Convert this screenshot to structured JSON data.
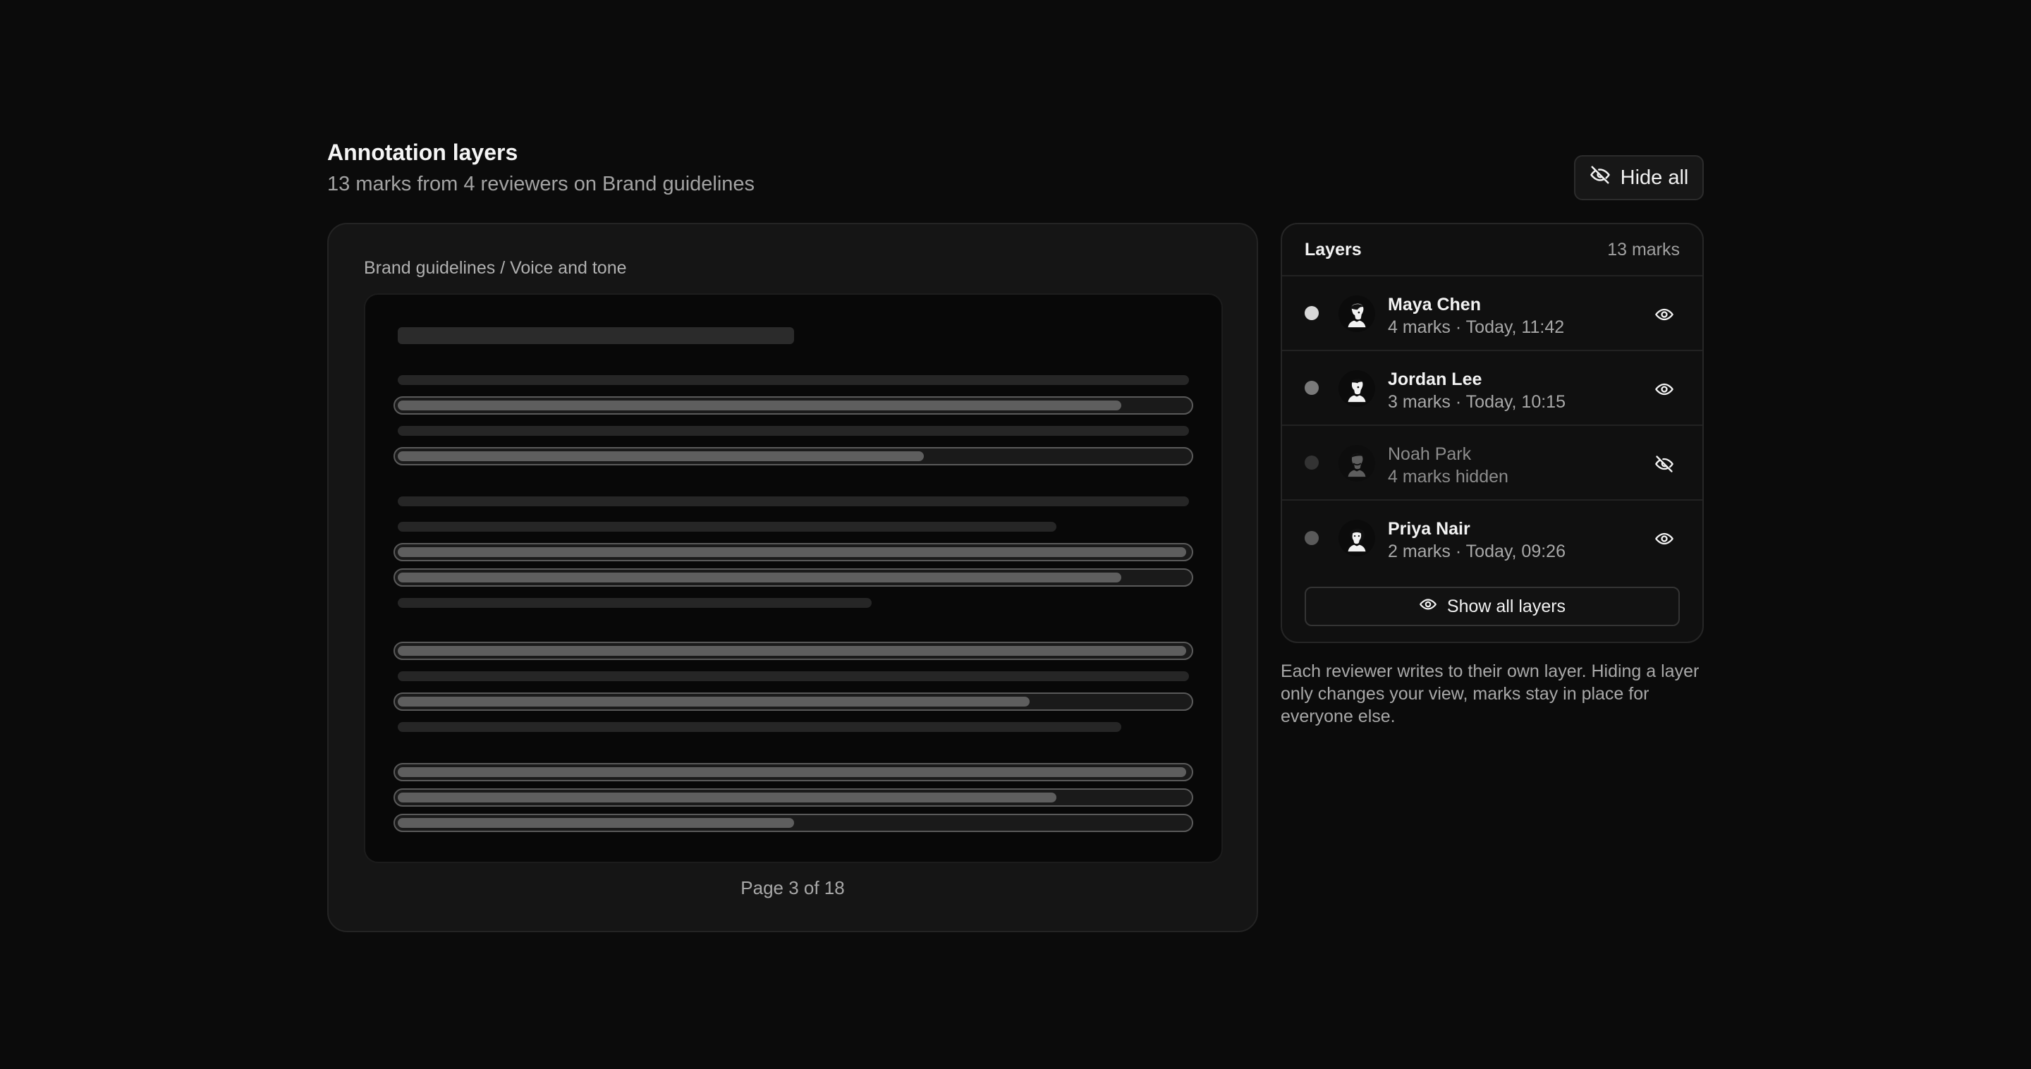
{
  "header": {
    "title": "Annotation layers",
    "subtitle": "13 marks from 4 reviewers on Brand guidelines",
    "hide_all_label": "Hide all"
  },
  "document": {
    "breadcrumb": "Brand guidelines / Voice and tone",
    "page_indicator": "Page 3 of 18"
  },
  "layers": {
    "title": "Layers",
    "count": "13 marks",
    "items": [
      {
        "name": "Maya Chen",
        "meta": "4 marks · Today, 11:42",
        "visible": true
      },
      {
        "name": "Jordan Lee",
        "meta": "3 marks · Today, 10:15",
        "visible": true
      },
      {
        "name": "Noah Park",
        "meta": "4 marks hidden",
        "visible": false
      },
      {
        "name": "Priya Nair",
        "meta": "2 marks · Today, 09:26",
        "visible": true
      }
    ],
    "show_all_label": "Show all layers"
  },
  "note": "Each reviewer writes to their own layer. Hiding a layer only changes your view, marks stay in place for everyone else.",
  "icons": {
    "hide_all": "eye-off-icon",
    "layer_visible": "eye-icon",
    "layer_hidden": "eye-off-icon",
    "show_all": "eye-icon"
  }
}
